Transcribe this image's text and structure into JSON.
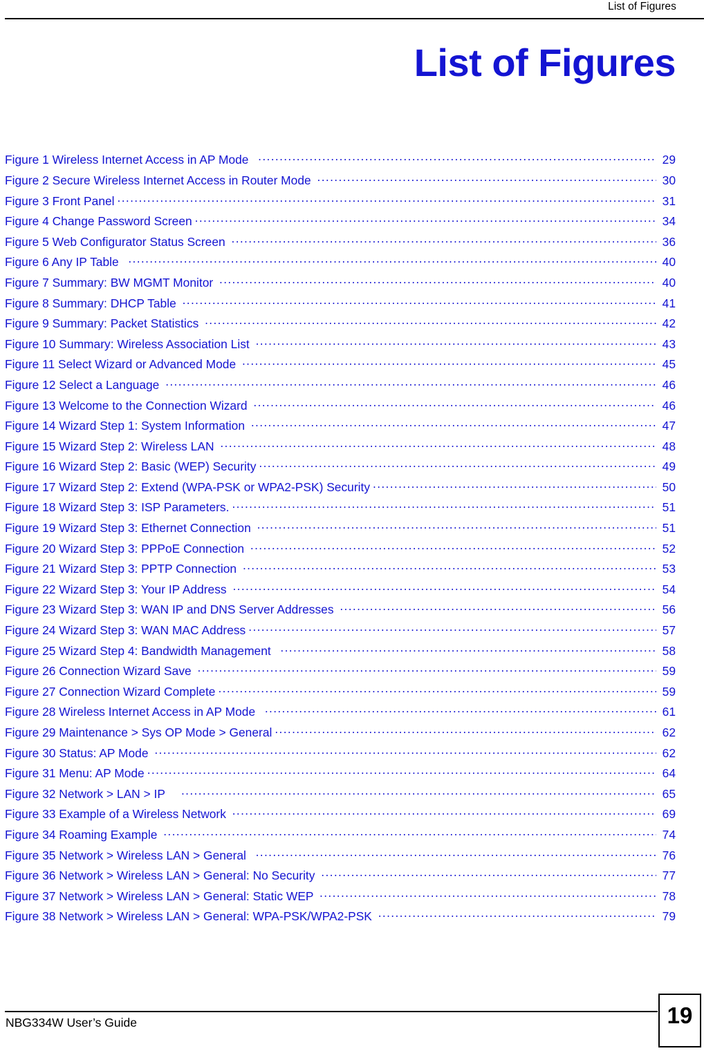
{
  "header": {
    "running_head": "List of Figures"
  },
  "title": "List of Figures",
  "figures": [
    {
      "label": "Figure 1 Wireless Internet Access in AP Mode  ",
      "page": "29"
    },
    {
      "label": "Figure 2 Secure Wireless Internet Access in Router Mode ",
      "page": "30"
    },
    {
      "label": "Figure 3 Front Panel",
      "page": "31"
    },
    {
      "label": "Figure 4 Change Password Screen",
      "page": "34"
    },
    {
      "label": "Figure 5 Web Configurator Status Screen ",
      "page": "36"
    },
    {
      "label": "Figure 6 Any IP Table  ",
      "page": "40"
    },
    {
      "label": "Figure 7 Summary: BW MGMT Monitor ",
      "page": "40"
    },
    {
      "label": "Figure 8 Summary: DHCP Table ",
      "page": "41"
    },
    {
      "label": "Figure 9 Summary: Packet Statistics ",
      "page": "42"
    },
    {
      "label": "Figure 10 Summary: Wireless Association List ",
      "page": "43"
    },
    {
      "label": "Figure 11 Select Wizard or Advanced Mode ",
      "page": "45"
    },
    {
      "label": "Figure 12 Select a Language ",
      "page": "46"
    },
    {
      "label": "Figure 13 Welcome to the Connection Wizard ",
      "page": "46"
    },
    {
      "label": "Figure 14 Wizard Step 1: System Information ",
      "page": "47"
    },
    {
      "label": "Figure 15 Wizard Step 2: Wireless LAN ",
      "page": "48"
    },
    {
      "label": "Figure 16 Wizard Step 2: Basic (WEP) Security",
      "page": "49"
    },
    {
      "label": "Figure 17 Wizard Step 2: Extend (WPA-PSK or WPA2-PSK) Security",
      "page": "50"
    },
    {
      "label": "Figure 18 Wizard Step 3: ISP Parameters.",
      "page": "51"
    },
    {
      "label": "Figure 19 Wizard Step 3: Ethernet Connection ",
      "page": "51"
    },
    {
      "label": "Figure 20 Wizard Step 3: PPPoE Connection ",
      "page": "52"
    },
    {
      "label": "Figure 21 Wizard Step 3: PPTP Connection ",
      "page": "53"
    },
    {
      "label": "Figure 22 Wizard Step 3: Your IP Address ",
      "page": "54"
    },
    {
      "label": "Figure 23 Wizard Step 3: WAN IP and DNS Server Addresses ",
      "page": "56"
    },
    {
      "label": "Figure 24 Wizard Step 3: WAN MAC Address",
      "page": "57"
    },
    {
      "label": "Figure 25 Wizard Step 4: Bandwidth Management  ",
      "page": "58"
    },
    {
      "label": "Figure 26 Connection Wizard Save ",
      "page": "59"
    },
    {
      "label": "Figure 27 Connection Wizard Complete",
      "page": "59"
    },
    {
      "label": "Figure 28 Wireless Internet Access in AP Mode  ",
      "page": "61"
    },
    {
      "label": "Figure 29 Maintenance > Sys OP Mode > General",
      "page": "62"
    },
    {
      "label": "Figure 30 Status: AP Mode ",
      "page": "62"
    },
    {
      "label": "Figure 31 Menu: AP Mode",
      "page": "64"
    },
    {
      "label": "Figure 32 Network > LAN > IP    ",
      "page": "65"
    },
    {
      "label": "Figure 33 Example of a Wireless Network ",
      "page": "69"
    },
    {
      "label": "Figure 34 Roaming Example ",
      "page": "74"
    },
    {
      "label": "Figure 35 Network > Wireless LAN > General  ",
      "page": "76"
    },
    {
      "label": "Figure 36 Network > Wireless LAN > General: No Security ",
      "page": "77"
    },
    {
      "label": "Figure 37 Network > Wireless LAN > General: Static WEP ",
      "page": "78"
    },
    {
      "label": "Figure 38 Network > Wireless LAN > General: WPA-PSK/WPA2-PSK ",
      "page": "79"
    }
  ],
  "footer": {
    "guide_name": "NBG334W User’s Guide",
    "page_number": "19"
  },
  "colors": {
    "link_blue": "#1414d2",
    "text_black": "#000000",
    "page_background": "#ffffff"
  }
}
